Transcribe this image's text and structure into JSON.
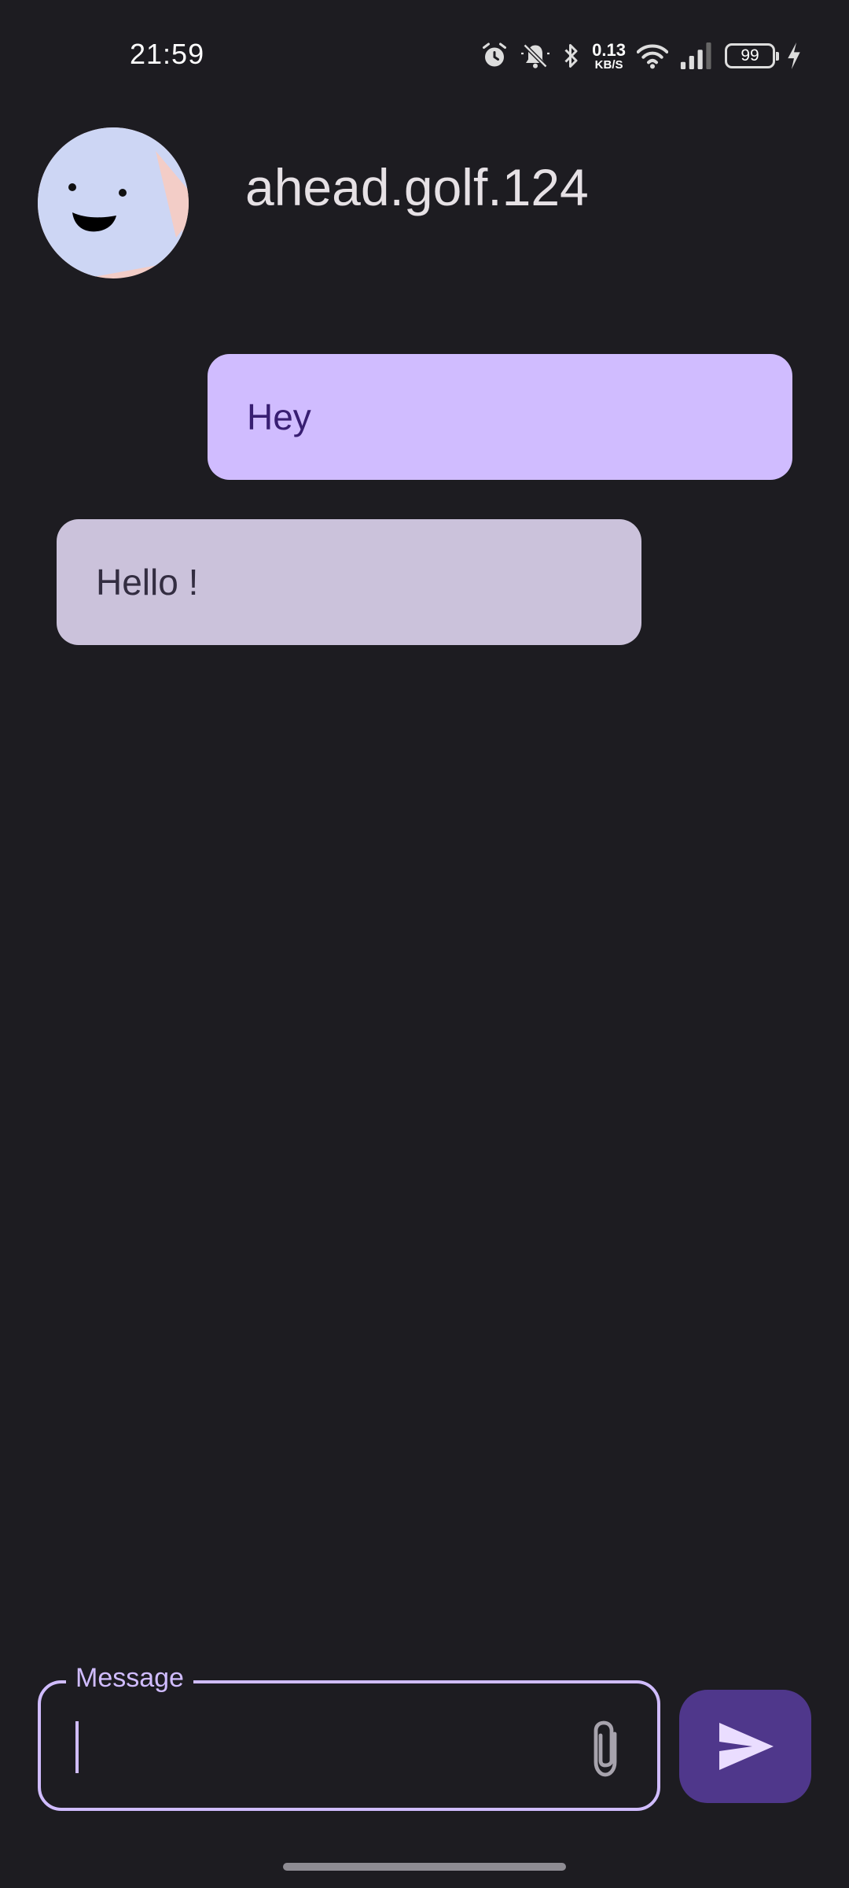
{
  "status_bar": {
    "time": "21:59",
    "net_speed_value": "0.13",
    "net_speed_unit": "KB/S",
    "battery_level": "99",
    "icons": [
      "alarm-icon",
      "bell-muted-icon",
      "bluetooth-icon",
      "wifi-icon",
      "signal-icon",
      "battery-icon",
      "charging-icon"
    ]
  },
  "header": {
    "contact_name": "ahead.golf.124",
    "avatar_icon": "smiley-avatar"
  },
  "messages": [
    {
      "direction": "outgoing",
      "text": "Hey"
    },
    {
      "direction": "incoming",
      "text": "Hello !"
    }
  ],
  "composer": {
    "label": "Message",
    "value": "",
    "attach_icon": "paperclip-icon",
    "send_icon": "send-icon"
  },
  "colors": {
    "background": "#1d1c21",
    "outgoing_bubble": "#d0bcff",
    "incoming_bubble": "#cbc2db",
    "accent": "#d0bcff",
    "send_button": "#4f378b"
  }
}
